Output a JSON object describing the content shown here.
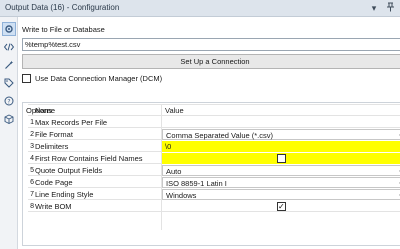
{
  "window": {
    "title": "Output Data (16) - Configuration"
  },
  "sidebar": {
    "items": [
      {
        "icon": "gear-icon"
      },
      {
        "icon": "code-icon"
      },
      {
        "icon": "wand-icon"
      },
      {
        "icon": "tag-icon"
      },
      {
        "icon": "help-icon"
      },
      {
        "icon": "cube-icon"
      }
    ]
  },
  "main": {
    "write_label": "Write to File or Database",
    "write_value": "%temp%test.csv",
    "setup_button": "Set Up a Connection",
    "dcm_label": "Use Data Connection Manager (DCM)",
    "dcm_checked": false,
    "options_title": "Options",
    "grid": {
      "name_header": "Name",
      "value_header": "Value",
      "rows": [
        {
          "num": "1",
          "name": "Max Records Per File",
          "value": "",
          "type": "text"
        },
        {
          "num": "2",
          "name": "File Format",
          "value": "Comma Separated Value (*.csv)",
          "type": "dropdown"
        },
        {
          "num": "3",
          "name": "Delimiters",
          "value": "\\0",
          "type": "text",
          "highlight": true
        },
        {
          "num": "4",
          "name": "First Row Contains Field Names",
          "value": "",
          "type": "checkbox",
          "checked": false,
          "highlight": true
        },
        {
          "num": "5",
          "name": "Quote Output Fields",
          "value": "Auto",
          "type": "dropdown"
        },
        {
          "num": "6",
          "name": "Code Page",
          "value": "ISO 8859-1 Latin I",
          "type": "dropdown"
        },
        {
          "num": "7",
          "name": "Line Ending Style",
          "value": "Windows",
          "type": "dropdown"
        },
        {
          "num": "8",
          "name": "Write BOM",
          "value": "",
          "type": "checkbox",
          "checked": true
        }
      ]
    },
    "highlight_color": "#ffff00"
  }
}
